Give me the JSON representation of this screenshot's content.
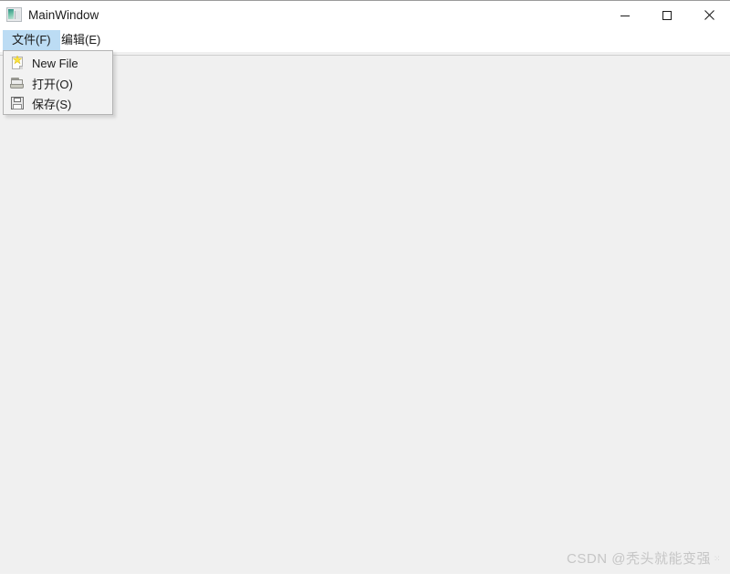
{
  "window": {
    "title": "MainWindow",
    "app_icon": "picture-icon",
    "controls": [
      {
        "name": "minimize",
        "glyph": "minimize-icon"
      },
      {
        "name": "maximize",
        "glyph": "maximize-icon"
      },
      {
        "name": "close",
        "glyph": "close-icon"
      }
    ]
  },
  "menubar": {
    "items": [
      {
        "label": "文件(F)",
        "name": "menu-file",
        "active": true
      },
      {
        "label": "编辑(E)",
        "name": "menu-edit",
        "active": false
      }
    ]
  },
  "file_menu": {
    "open": true,
    "items": [
      {
        "label": "New File",
        "icon": "new-file-icon"
      },
      {
        "label": "打开(O)",
        "icon": "open-folder-icon"
      },
      {
        "label": "保存(S)",
        "icon": "save-floppy-icon"
      }
    ]
  },
  "watermark": {
    "text": "CSDN @秃头就能变强",
    "trailing": "⁙"
  },
  "colors": {
    "menu_highlight": "#bcdcf4",
    "client_background": "#f0f0f0",
    "titlebar_background": "#ffffff",
    "popup_background": "#f2f2f2",
    "popup_border": "#b4b4b4",
    "text": "#1b1b1b",
    "watermark": "#c6c6c6"
  }
}
